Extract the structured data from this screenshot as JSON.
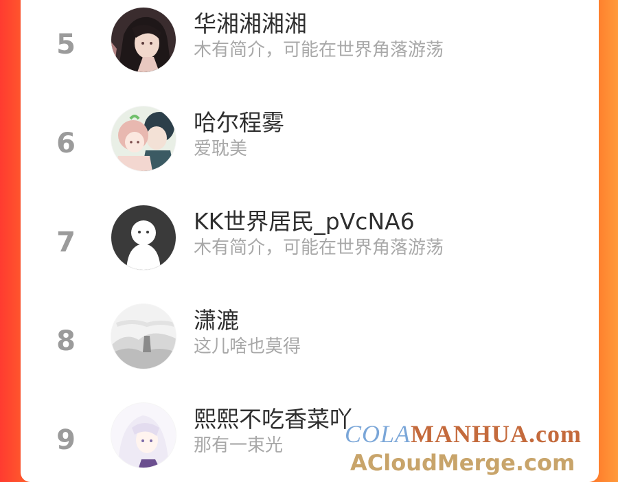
{
  "users": [
    {
      "rank": "5",
      "name": "华湘湘湘湘",
      "bio": "木有简介，可能在世界角落游荡",
      "avatar_icon": "anime-portrait-dark-hair"
    },
    {
      "rank": "6",
      "name": "哈尔程雾",
      "bio": "爱耽美",
      "avatar_icon": "anime-pair-portrait"
    },
    {
      "rank": "7",
      "name": "KK世界居民_pVcNA6",
      "bio": "木有简介，可能在世界角落游荡",
      "avatar_icon": "default-ghost-avatar"
    },
    {
      "rank": "8",
      "name": "潇漉",
      "bio": "这儿啥也莫得",
      "avatar_icon": "misty-landscape-avatar"
    },
    {
      "rank": "9",
      "name": "熙熙不吃香菜吖",
      "bio": "那有一束光",
      "avatar_icon": "white-hair-anime-avatar"
    }
  ],
  "watermark": {
    "line1_a": "COLA",
    "line1_b": "MANHUA",
    "line1_c": ".com",
    "line2": "ACloudMerge.com"
  },
  "colors": {
    "rank": "#9b9b9b",
    "name": "#2e2e2e",
    "bio": "#a8a8a8",
    "frame": "#ff5a2c"
  }
}
